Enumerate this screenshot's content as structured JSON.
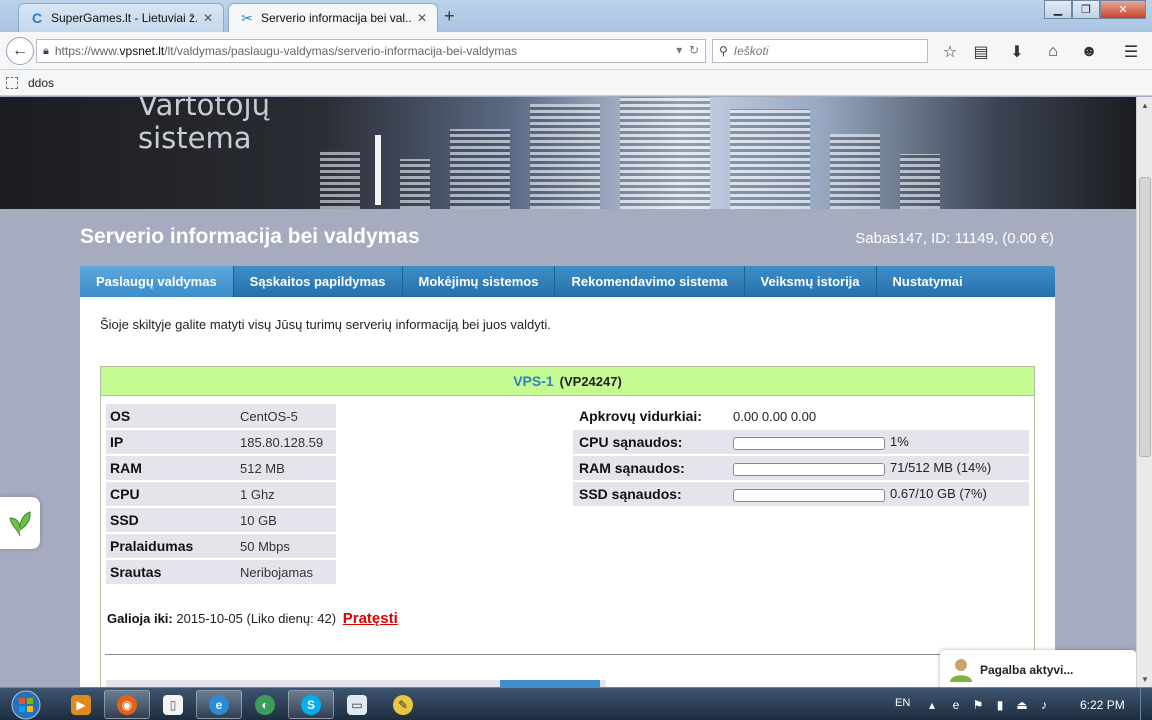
{
  "browser": {
    "tabs": [
      {
        "title": "SuperGames.lt - Lietuviai ž...",
        "active": false
      },
      {
        "title": "Serverio informacija bei val...",
        "active": true
      }
    ],
    "url": {
      "prefix": "https://www.",
      "host": "vpsnet.lt",
      "path": "/lt/valdymas/paslaugu-valdymas/serverio-informacija-bei-valdymas"
    },
    "search_placeholder": "Ieškoti",
    "bookmarks": [
      {
        "label": "ddos"
      }
    ]
  },
  "banner": {
    "line1": "Vartotojų",
    "line2": "sistema"
  },
  "page": {
    "title": "Serverio informacija bei valdymas",
    "user_info": "Sabas147, ID: 11149, (0.00 €)",
    "intro": "Šioje skiltyje galite matyti visų Jūsų turimų serverių informaciją bei juos valdyti."
  },
  "menu": [
    {
      "label": "Paslaugų valdymas",
      "active": true
    },
    {
      "label": "Sąskaitos papildymas",
      "active": false
    },
    {
      "label": "Mokėjimų sistemos",
      "active": false
    },
    {
      "label": "Rekomendavimo sistema",
      "active": false
    },
    {
      "label": "Veiksmų istorija",
      "active": false
    },
    {
      "label": "Nustatymai",
      "active": false
    }
  ],
  "server": {
    "name": "VPS-1",
    "code": "(VP24247)",
    "specs": [
      {
        "key": "OS",
        "value": "CentOS-5"
      },
      {
        "key": "IP",
        "value": "185.80.128.59"
      },
      {
        "key": "RAM",
        "value": "512 MB"
      },
      {
        "key": "CPU",
        "value": "1 Ghz"
      },
      {
        "key": "SSD",
        "value": "10 GB"
      },
      {
        "key": "Pralaidumas",
        "value": "50 Mbps"
      },
      {
        "key": "Srautas",
        "value": "Neribojamas"
      }
    ],
    "load_label": "Apkrovų vidurkiai:",
    "load_value": "0.00 0.00 0.00",
    "usage": [
      {
        "key": "CPU sąnaudos:",
        "percent": 1,
        "text": "1%"
      },
      {
        "key": "RAM sąnaudos:",
        "percent": 14,
        "text": "71/512 MB (14%)"
      },
      {
        "key": "SSD sąnaudos:",
        "percent": 7,
        "text": "0.67/10 GB (7%)"
      }
    ],
    "expiry_label": "Galioja iki:",
    "expiry_value": "2015-10-05 (Liko dienų: 42)",
    "renew_label": "Pratęsti"
  },
  "help_widget": {
    "label": "Pagalba aktyvi..."
  },
  "taskbar": {
    "lang": "EN",
    "clock": "6:22 PM"
  },
  "colors": {
    "menu": "#2f7dbb",
    "server_header": "#c6fb93",
    "bar_fill": "#f39c12",
    "renew": "#dd0000"
  }
}
